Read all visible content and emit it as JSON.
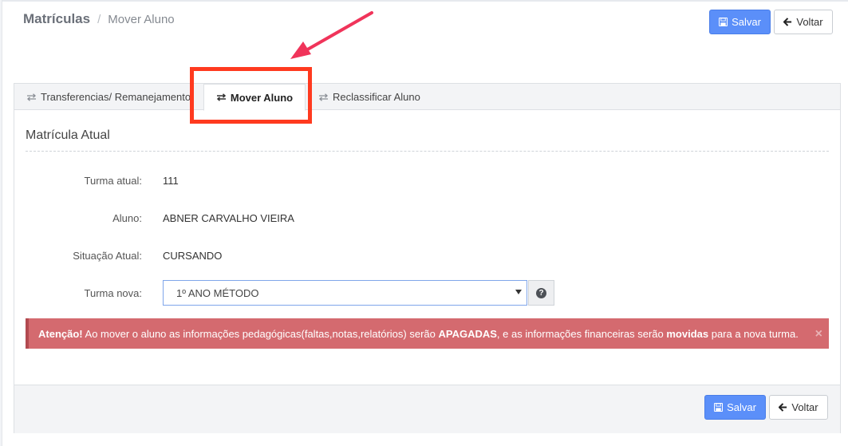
{
  "breadcrumb": {
    "root": "Matrículas",
    "separator": "/",
    "current": "Mover Aluno"
  },
  "header_actions": {
    "save_label": "Salvar",
    "back_label": "Voltar"
  },
  "tabs": [
    {
      "label": "Transferencias/ Remanejamento",
      "icon": "exchange-icon",
      "active": false
    },
    {
      "label": "Mover Aluno",
      "icon": "exchange-icon",
      "active": true
    },
    {
      "label": "Reclassificar Aluno",
      "icon": "exchange-icon",
      "active": false
    }
  ],
  "section": {
    "title": "Matrícula Atual"
  },
  "fields": {
    "turma_atual": {
      "label": "Turma atual:",
      "value": "111"
    },
    "aluno": {
      "label": "Aluno:",
      "value": "ABNER CARVALHO VIEIRA"
    },
    "situacao": {
      "label": "Situação Atual:",
      "value": "CURSANDO"
    },
    "turma_nova": {
      "label": "Turma nova:",
      "selected": "1º ANO MÉTODO"
    }
  },
  "alert": {
    "strong": "Atenção!",
    "text1": " Ao mover o aluno as informações pedagógicas(faltas,notas,relatórios) serão ",
    "bold1": "APAGADAS",
    "text2": ", e as informações financeiras serão ",
    "bold2": "movidas",
    "text3": " para a nova turma.",
    "close": "×"
  },
  "footer_actions": {
    "save_label": "Salvar",
    "back_label": "Voltar"
  },
  "colors": {
    "primary": "#5b8ff9",
    "alert": "#d46a6f",
    "highlight": "#ff3a1f",
    "arrow": "#f0345a"
  }
}
